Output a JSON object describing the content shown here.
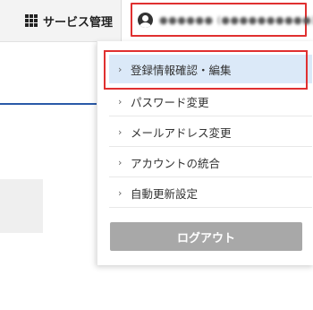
{
  "header": {
    "service_label": "サービス管理",
    "service_icon": "grid-icon",
    "user_display": "●●●●●● (●●●●●●●●●●)",
    "user_icon": "user-circle-icon"
  },
  "menu": {
    "items": [
      {
        "label": "登録情報確認・編集",
        "active": true
      },
      {
        "label": "パスワード変更",
        "active": false
      },
      {
        "label": "メールアドレス変更",
        "active": false
      },
      {
        "label": "アカウントの統合",
        "active": false
      },
      {
        "label": "自動更新設定",
        "active": false
      }
    ],
    "logout_label": "ログアウト"
  },
  "colors": {
    "highlight_border": "#e03030",
    "active_bg": "#dbe9f8",
    "logout_bg": "#a8a8a8",
    "accent_line": "#2a5aa8"
  }
}
